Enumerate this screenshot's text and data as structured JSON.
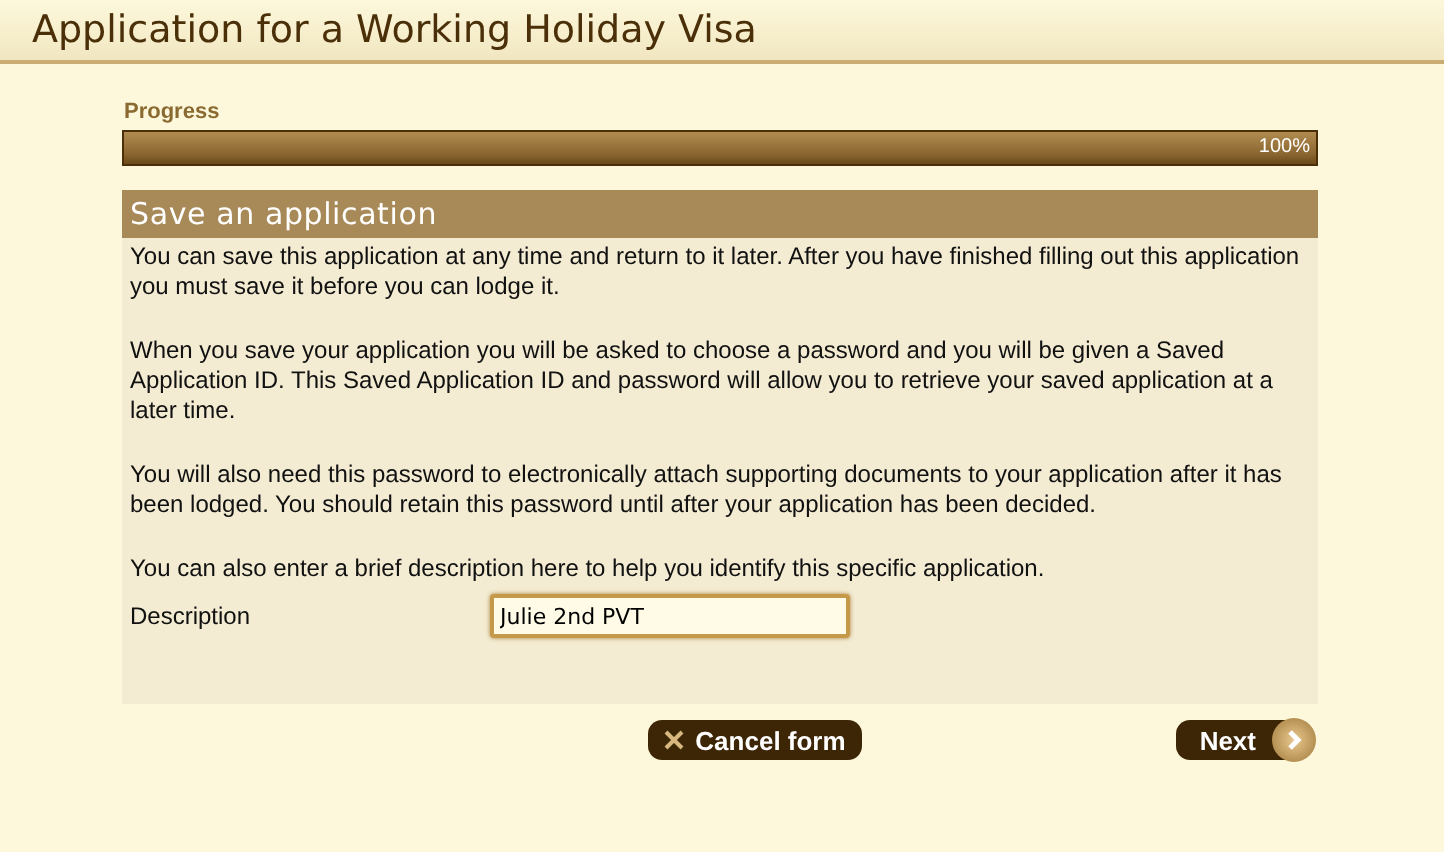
{
  "window": {
    "title": "Application for a Working Holiday Visa"
  },
  "progress": {
    "label": "Progress",
    "level": 1,
    "reading": "100%"
  },
  "section": {
    "title": "Save an application",
    "paragraphs": [
      "You can save this application at any time and return to it later. After you have finished filling out this application you must save it before you can lodge it.",
      "When you save your application you will be asked to choose a password and you will be given a Saved Application ID. This Saved Application ID and password will allow you to retrieve your saved application at a later time.",
      "You will also need this password to electronically attach supporting documents to your application after it has been lodged. You should retain this password until after your application has been decided.",
      "You can also enter a brief description here to help you identify this specific application."
    ],
    "field": {
      "label": "Description",
      "value": "Julie 2nd PVT"
    }
  },
  "buttons": [
    {
      "kind": "cancel",
      "label": "Cancel form"
    },
    {
      "kind": "next",
      "label": "Next"
    }
  ]
}
